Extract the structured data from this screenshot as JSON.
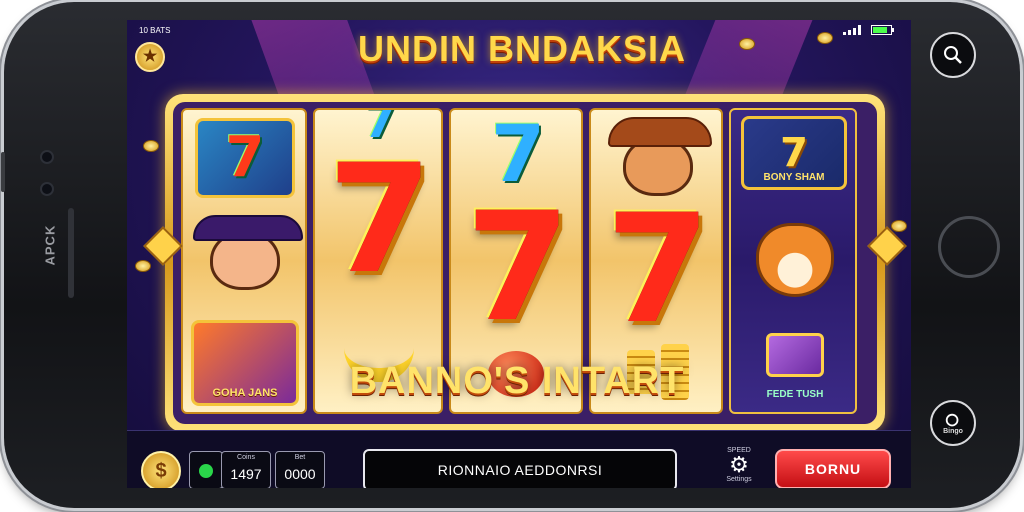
{
  "device": {
    "brand_label": "APCK",
    "search_button_label": "Search",
    "bottom_button_label": "Bingo"
  },
  "status_bar": {
    "left_text": "10 BATS"
  },
  "game": {
    "title": "UNDIN BNDAKSIA",
    "banner": "BANNO'S INTART",
    "reel_tiles": {
      "reel5_top": "BONY SHAM",
      "reel1_bottom": "GOHA JANS",
      "reel5_bottom": "FEDE TUSH"
    }
  },
  "controls": {
    "credits_caption": "Coins",
    "credits_value": "1497",
    "bet_caption": "Bet",
    "bet_value": "0000",
    "message": "RIONNAIO AEDDONRSI",
    "settings_caption_top": "SPEED",
    "settings_caption_bottom": "Settings",
    "bonus_button": "BORNU"
  },
  "colors": {
    "accent_gold": "#ffd84a",
    "bonus_red": "#e0171c",
    "seven_red": "#ff2a1a"
  },
  "icons": {
    "settings": "gear-icon",
    "search": "search-icon",
    "coin": "coin-icon",
    "battery": "battery-icon",
    "signal": "signal-icon"
  }
}
